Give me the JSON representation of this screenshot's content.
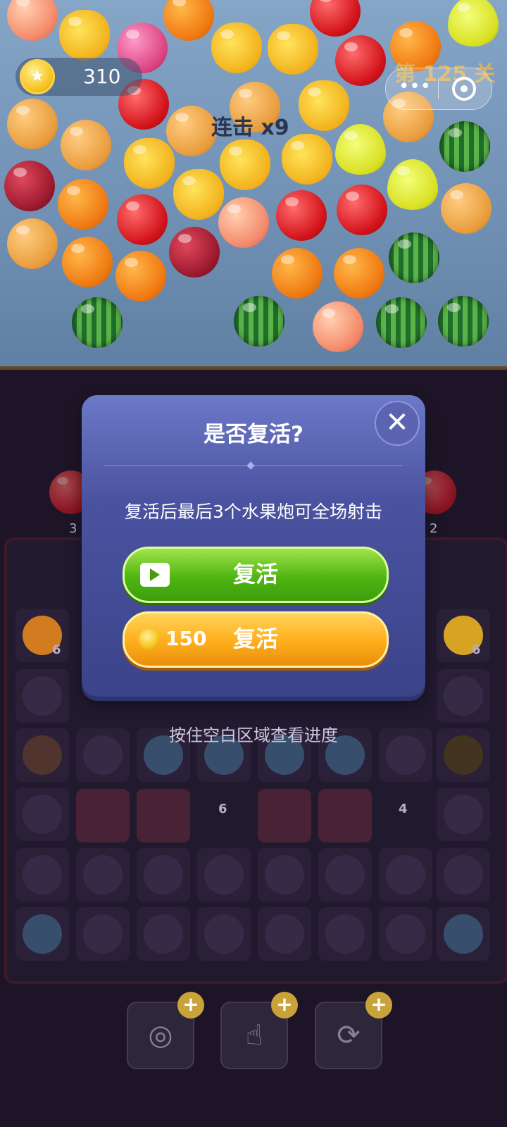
{
  "hud": {
    "coins": "310",
    "level": "第 125 关",
    "combo": "连击 x9"
  },
  "dialog": {
    "title": "是否复活?",
    "description": "复活后最后3个水果炮可全场射击",
    "video_revive_label": "复活",
    "coin_revive_cost": "150",
    "coin_revive_label": "复活",
    "close_icon": "close-icon"
  },
  "hint": "按住空白区域查看进度",
  "side_counts": {
    "left": "3",
    "right": "2"
  },
  "board_counts": {
    "left_cell": "6",
    "right_cell": "6",
    "bucket_a": "6",
    "bucket_b": "4"
  },
  "tools": [
    {
      "name": "target-tool",
      "icon": "target-icon"
    },
    {
      "name": "tap-tool",
      "icon": "hand-pointer-icon"
    },
    {
      "name": "shuffle-tool",
      "icon": "refresh-icon"
    }
  ]
}
